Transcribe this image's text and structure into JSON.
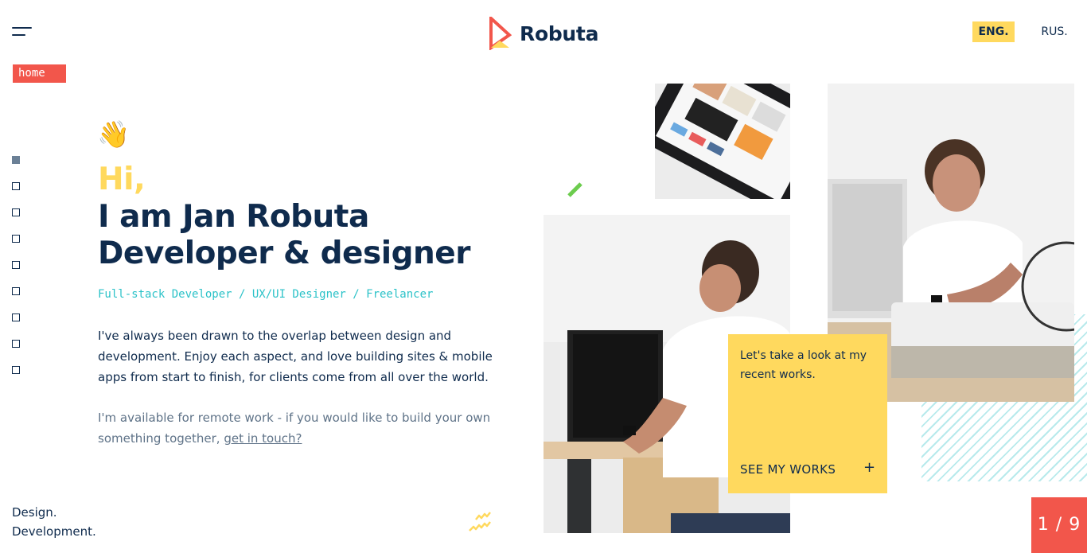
{
  "header": {
    "menu_icon": "hamburger-menu-icon",
    "logo_text": "Robuta",
    "logo_icon": "robuta-triangle-logo",
    "languages": [
      {
        "label": "ENG.",
        "active": true
      },
      {
        "label": "RUS.",
        "active": false
      }
    ]
  },
  "section_tag": "home",
  "section_nav": {
    "count": 9,
    "active_index": 0
  },
  "hero": {
    "emoji": "👋",
    "greeting": "Hi,",
    "headline_lines": [
      "I am Jan Robuta",
      "Developer & designer"
    ],
    "roles": "Full-stack Developer / UX/UI Designer / Freelancer",
    "about": "I've always been drawn to the overlap between design and development. Enjoy each aspect, and love building sites & mobile apps from start to finish, for clients come from all over the world.",
    "remote_text": "I'm available for remote work - if you would like to build your own something together,",
    "remote_link": "get in touch?"
  },
  "tagline": [
    "Design.",
    "Development."
  ],
  "works_card": {
    "text": "Let's take a look at my recent works.",
    "button_label": "SEE MY WORKS",
    "button_icon": "plus-icon"
  },
  "pagination": "1 / 9",
  "colors": {
    "navy": "#0f2b4d",
    "yellow": "#ffd95e",
    "coral": "#f2564b",
    "teal": "#2bc2c8",
    "green": "#6ccc4e"
  }
}
